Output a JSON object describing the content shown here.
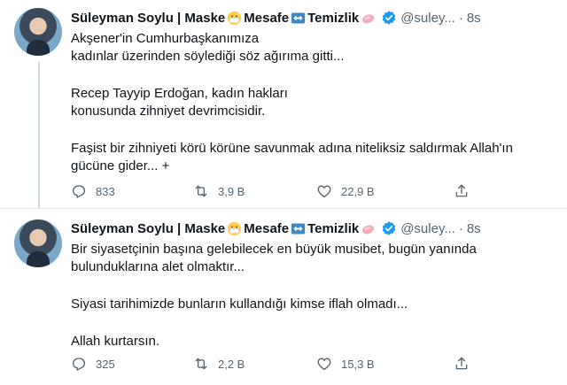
{
  "tweets": [
    {
      "author": {
        "name": "Süleyman Soylu | Maske",
        "name_part2": "Mesafe",
        "name_part3": "Temizlik",
        "handle": "@suley...",
        "time": "8s"
      },
      "lines": [
        "Akşener'in Cumhurbaşkanımıza",
        "kadınlar üzerinden söylediği söz ağırıma gitti...",
        "",
        "Recep Tayyip Erdoğan, kadın hakları",
        "konusunda zihniyet devrimcisidir.",
        "",
        "Faşist bir zihniyeti körü körüne savunmak adına niteliksiz saldırmak Allah'ın",
        "gücüne gider... +"
      ],
      "actions": {
        "replies": "833",
        "retweets": "3,9 B",
        "likes": "22,9 B"
      }
    },
    {
      "author": {
        "name": "Süleyman Soylu | Maske",
        "name_part2": "Mesafe",
        "name_part3": "Temizlik",
        "handle": "@suley...",
        "time": "8s"
      },
      "lines": [
        "Bir siyasetçinin başına gelebilecek en büyük musibet, bugün yanında",
        "bulunduklarına alet olmaktır...",
        "",
        "Siyasi tarihimizde bunların kullandığı kimse iflah olmadı...",
        "",
        "Allah kurtarsın."
      ],
      "actions": {
        "replies": "325",
        "retweets": "2,2 B",
        "likes": "15,3 B"
      }
    }
  ],
  "icons": {
    "mask_emoji": "mask-emoji-icon",
    "arrow_emoji": "left-right-arrow-emoji-icon",
    "soap_emoji": "soap-emoji-icon",
    "verified": "verified-badge-icon",
    "reply": "reply-icon",
    "retweet": "retweet-icon",
    "like": "heart-icon",
    "share": "share-icon"
  },
  "colors": {
    "verified": "#1d9bf0",
    "secondary_text": "#536471",
    "divider": "#e6ecf0"
  }
}
